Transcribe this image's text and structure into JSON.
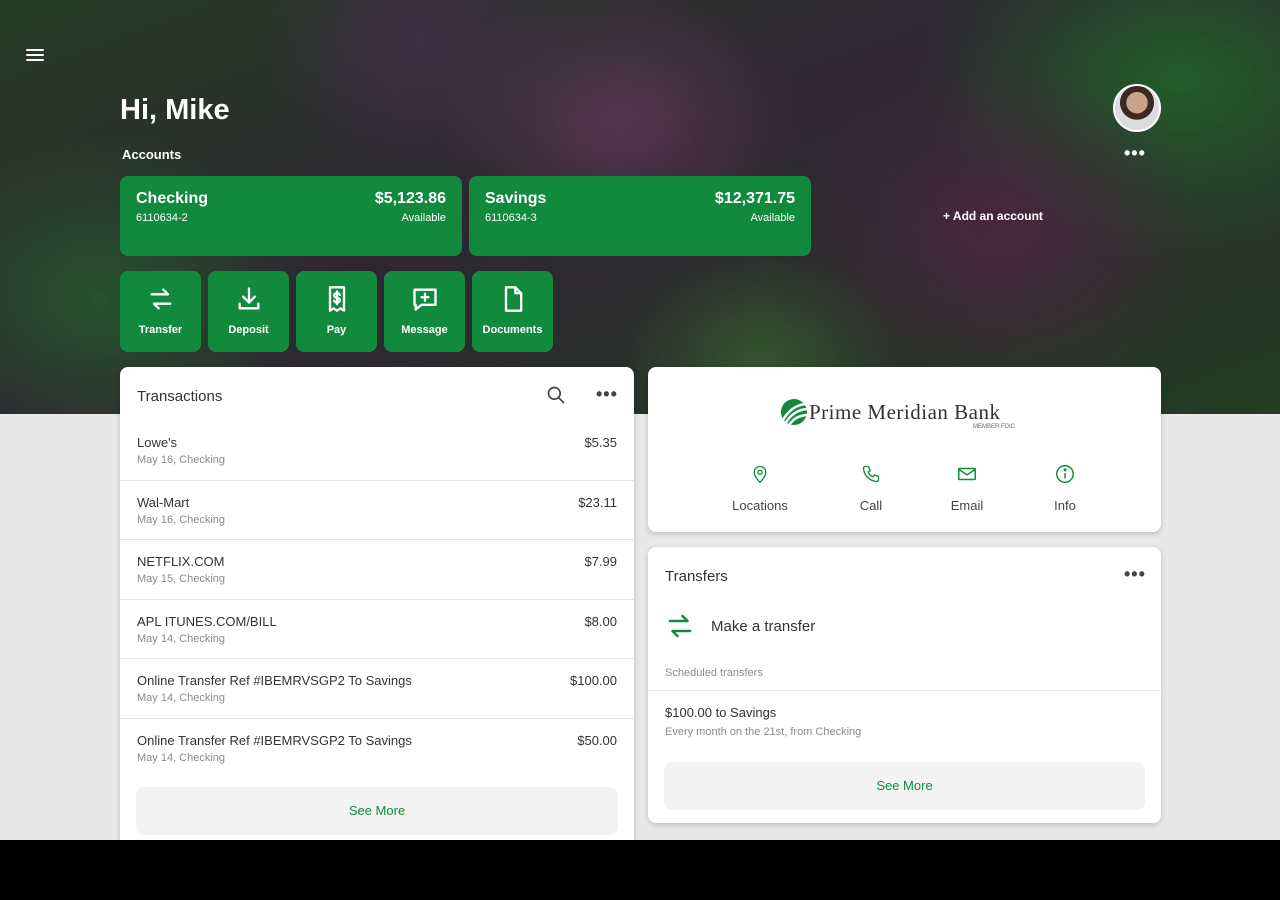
{
  "header": {
    "greeting": "Hi, Mike",
    "accounts_label": "Accounts",
    "add_account": "+ Add an account"
  },
  "accounts": [
    {
      "name": "Checking",
      "number": "6110634-2",
      "balance": "$5,123.86",
      "status": "Available"
    },
    {
      "name": "Savings",
      "number": "6110634-3",
      "balance": "$12,371.75",
      "status": "Available"
    }
  ],
  "quick_actions": [
    {
      "label": "Transfer",
      "icon": "transfer-icon"
    },
    {
      "label": "Deposit",
      "icon": "deposit-icon"
    },
    {
      "label": "Pay",
      "icon": "pay-icon"
    },
    {
      "label": "Message",
      "icon": "message-icon"
    },
    {
      "label": "Documents",
      "icon": "documents-icon"
    }
  ],
  "transactions": {
    "title": "Transactions",
    "items": [
      {
        "desc": "Lowe's",
        "sub": "May 16, Checking",
        "amount": "$5.35"
      },
      {
        "desc": "Wal-Mart",
        "sub": "May 16, Checking",
        "amount": "$23.11"
      },
      {
        "desc": "NETFLIX.COM",
        "sub": "May 15, Checking",
        "amount": "$7.99"
      },
      {
        "desc": "APL ITUNES.COM/BILL",
        "sub": "May 14, Checking",
        "amount": "$8.00"
      },
      {
        "desc": "Online Transfer Ref #IBEMRVSGP2 To Savings",
        "sub": "May 14, Checking",
        "amount": "$100.00"
      },
      {
        "desc": "Online Transfer Ref #IBEMRVSGP2 To Savings",
        "sub": "May 14, Checking",
        "amount": "$50.00"
      }
    ],
    "see_more": "See More"
  },
  "bank": {
    "name": "Prime Meridian Bank",
    "member": "MEMBER FDIC",
    "contacts": [
      {
        "label": "Locations",
        "icon": "location-pin-icon"
      },
      {
        "label": "Call",
        "icon": "phone-icon"
      },
      {
        "label": "Email",
        "icon": "email-icon"
      },
      {
        "label": "Info",
        "icon": "info-icon"
      }
    ]
  },
  "transfers": {
    "title": "Transfers",
    "make_transfer": "Make a transfer",
    "scheduled_label": "Scheduled transfers",
    "scheduled": [
      {
        "title": "$100.00 to Savings",
        "sub": "Every month on the 21st, from Checking"
      }
    ],
    "see_more": "See More"
  },
  "colors": {
    "accent": "#128a3d",
    "background": "#e8e8e8"
  }
}
